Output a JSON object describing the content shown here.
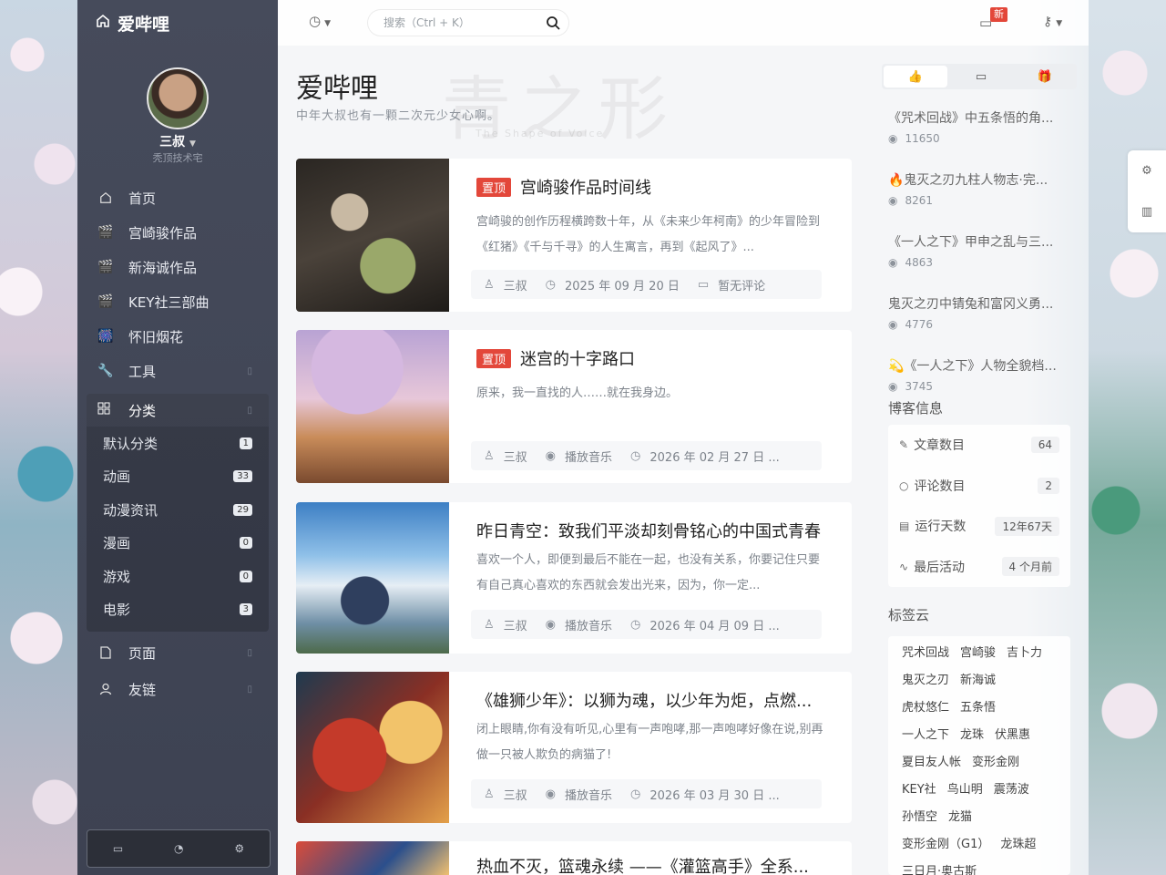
{
  "brand": {
    "title": "爱哔哩"
  },
  "user": {
    "name": "三叔",
    "subtitle": "秃顶技术宅"
  },
  "nav": [
    {
      "label": "首页",
      "icon": "home-icon"
    },
    {
      "label": "宫崎骏作品",
      "icon": "clapper-icon"
    },
    {
      "label": "新海诚作品",
      "icon": "clapper-icon"
    },
    {
      "label": "KEY社三部曲",
      "icon": "clapper-icon"
    },
    {
      "label": "怀旧烟花",
      "icon": "firework-icon"
    },
    {
      "label": "工具",
      "icon": "wrench-icon"
    }
  ],
  "category": {
    "label": "分类",
    "items": [
      {
        "label": "默认分类",
        "count": "1"
      },
      {
        "label": "动画",
        "count": "33"
      },
      {
        "label": "动漫资讯",
        "count": "29"
      },
      {
        "label": "漫画",
        "count": "0"
      },
      {
        "label": "游戏",
        "count": "0"
      },
      {
        "label": "电影",
        "count": "3"
      }
    ]
  },
  "nav_bottom": [
    {
      "label": "页面",
      "icon": "page-icon"
    },
    {
      "label": "友链",
      "icon": "user-icon"
    }
  ],
  "search": {
    "placeholder": "搜索（Ctrl + K）"
  },
  "topbar": {
    "new_badge": "新"
  },
  "header": {
    "title": "爱哔哩",
    "subtitle": "中年大叔也有一颗二次元少女心啊。"
  },
  "watermark": {
    "title": "青之形",
    "subtitle": "The Shape of Voice"
  },
  "posts": [
    {
      "pinned": "置顶",
      "title": "宫崎骏作品时间线",
      "excerpt": "宫崎骏的创作历程横跨数十年，从《未来少年柯南》的少年冒险到《红猪》《千与千寻》的人生寓言，再到《起风了》...",
      "author": "三叔",
      "extra": "",
      "date": "2025 年 09 月 20 日",
      "comments": "暂无评论"
    },
    {
      "pinned": "置顶",
      "title": "迷宫的十字路口",
      "excerpt": "原来，我一直找的人……就在我身边。",
      "author": "三叔",
      "extra": "播放音乐",
      "date": "2026 年 02 月 27 日 ...",
      "comments": ""
    },
    {
      "pinned": "",
      "title": "昨日青空：致我们平淡却刻骨铭心的中国式青春",
      "excerpt": "喜欢一个人，即便到最后不能在一起，也没有关系，你要记住只要有自己真心喜欢的东西就会发出光来，因为，你一定...",
      "author": "三叔",
      "extra": "播放音乐",
      "date": "2026 年 04 月 09 日 ...",
      "comments": ""
    },
    {
      "pinned": "",
      "title": "《雄狮少年》：以狮为魂，以少年为炬，点燃...",
      "excerpt": "闭上眼睛,你有没有听见,心里有一声咆哮,那一声咆哮好像在说,别再做一只被人欺负的病猫了!",
      "author": "三叔",
      "extra": "播放音乐",
      "date": "2026 年 03 月 30 日 ...",
      "comments": ""
    },
    {
      "pinned": "",
      "title": "热血不灭，篮魂永续 ——《灌篮高手》全系...",
      "excerpt": "",
      "author": "",
      "extra": "",
      "date": "",
      "comments": ""
    }
  ],
  "hot": [
    {
      "title": "《咒术回战》中五条悟的角...",
      "views": "11650"
    },
    {
      "title": "🔥鬼灭之刃九柱人物志·完...",
      "views": "8261"
    },
    {
      "title": "《一人之下》甲申之乱与三...",
      "views": "4863"
    },
    {
      "title": "鬼灭之刃中锖兔和富冈义勇...",
      "views": "4776"
    },
    {
      "title": "💫《一人之下》人物全貌档...",
      "views": "3745"
    }
  ],
  "blog_info": {
    "title": "博客信息",
    "rows": [
      {
        "label": "文章数目",
        "value": "64",
        "icon": "pen-icon"
      },
      {
        "label": "评论数目",
        "value": "2",
        "icon": "comment-icon"
      },
      {
        "label": "运行天数",
        "value": "12年67天",
        "icon": "calendar-icon"
      },
      {
        "label": "最后活动",
        "value": "4 个月前",
        "icon": "pulse-icon"
      }
    ]
  },
  "tags": {
    "title": "标签云",
    "items": [
      "咒术回战",
      "宫崎骏",
      "吉卜力",
      "鬼灭之刃",
      "新海诚",
      "虎杖悠仁",
      "五条悟",
      "一人之下",
      "龙珠",
      "伏黑惠",
      "夏目友人帐",
      "变形金刚",
      "KEY社",
      "鸟山明",
      "震荡波",
      "孙悟空",
      "龙猫",
      "变形金刚（G1）",
      "龙珠超",
      "三日月·奥古斯"
    ]
  }
}
